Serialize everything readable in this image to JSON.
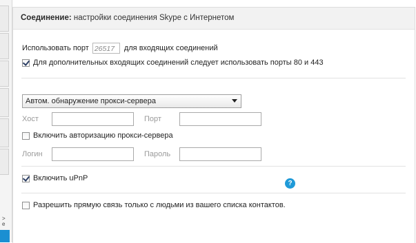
{
  "left_nav": {
    "marks": [
      ">",
      "e"
    ]
  },
  "header": {
    "section": "Соединение:",
    "subtitle": " настройки соединения Skype с Интернетом"
  },
  "port": {
    "prefix": "Использовать порт",
    "value": "26517",
    "suffix": "для входящих соединений"
  },
  "alt_ports": {
    "checked": true,
    "label": "Для дополнительных входящих соединений следует использовать порты 80 и 443"
  },
  "proxy": {
    "selected": "Автом. обнаружение прокси-сервера",
    "host_label": "Хост",
    "port_label": "Порт",
    "auth_checked": false,
    "auth_label": "Включить авторизацию прокси-сервера",
    "login_label": "Логин",
    "password_label": "Пароль"
  },
  "upnp": {
    "checked": true,
    "label": "Включить uPnP"
  },
  "direct": {
    "checked": false,
    "label": "Разрешить прямую связь только с людьми из вашего списка контактов.",
    "help_symbol": "?"
  },
  "colors": {
    "accent": "#1f9ad8",
    "selected_strip": "#1a8fd2",
    "header_bg": "#f2f2f2"
  }
}
